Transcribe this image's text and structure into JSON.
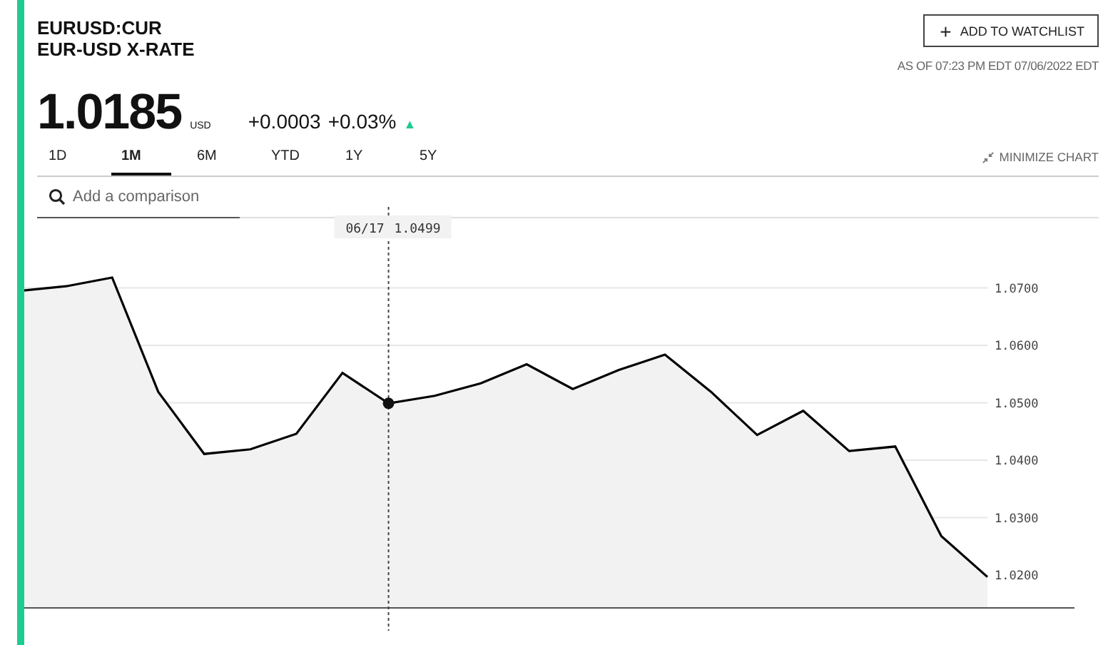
{
  "ticker": "EURUSD:CUR",
  "name": "EUR-USD X-RATE",
  "watchlist_button": {
    "icon": "+",
    "label": "ADD TO WATCHLIST"
  },
  "timestamp": "AS OF 07:23 PM EDT 07/06/2022 EDT",
  "price": {
    "value": "1.0185",
    "currency": "USD",
    "change": "+0.0003",
    "change_percent": "+0.03%",
    "arrow": "▲"
  },
  "ranges": [
    {
      "label": "1D",
      "selected": false
    },
    {
      "label": "1M",
      "selected": true
    },
    {
      "label": "6M",
      "selected": false
    },
    {
      "label": "YTD",
      "selected": false
    },
    {
      "label": "1Y",
      "selected": false
    },
    {
      "label": "5Y",
      "selected": false
    }
  ],
  "minimize_button": {
    "label": "MINIMIZE CHART"
  },
  "comparison": {
    "placeholder": "Add a comparison"
  },
  "chart": {
    "chart_data": {
      "type": "area",
      "categories": [
        null,
        null,
        null,
        null,
        null,
        null,
        null,
        null,
        null,
        null,
        null,
        null,
        null,
        null,
        null,
        null,
        null,
        null,
        null,
        null,
        null,
        null
      ],
      "series": [
        {
          "color": "#000000",
          "values": [
            1.0695,
            1.0703,
            1.0718,
            1.0519,
            1.0411,
            1.0419,
            1.0446,
            1.0552,
            1.0499,
            1.0512,
            1.0534,
            1.0567,
            1.0524,
            1.0557,
            1.0584,
            1.0519,
            1.0444,
            1.0486,
            1.0416,
            1.0424,
            1.0268,
            1.0197
          ]
        }
      ],
      "ylim": [
        1.0143,
        1.0841
      ],
      "yticks": [
        {
          "value": 1.07,
          "label": "1.0700"
        },
        {
          "value": 1.06,
          "label": "1.0600"
        },
        {
          "value": 1.05,
          "label": "1.0500"
        },
        {
          "value": 1.04,
          "label": "1.0400"
        },
        {
          "value": 1.03,
          "label": "1.0300"
        },
        {
          "value": 1.02,
          "label": "1.0200"
        }
      ],
      "grid": true
    },
    "tooltip": {
      "date": "06/17",
      "value": "1.0499"
    }
  }
}
